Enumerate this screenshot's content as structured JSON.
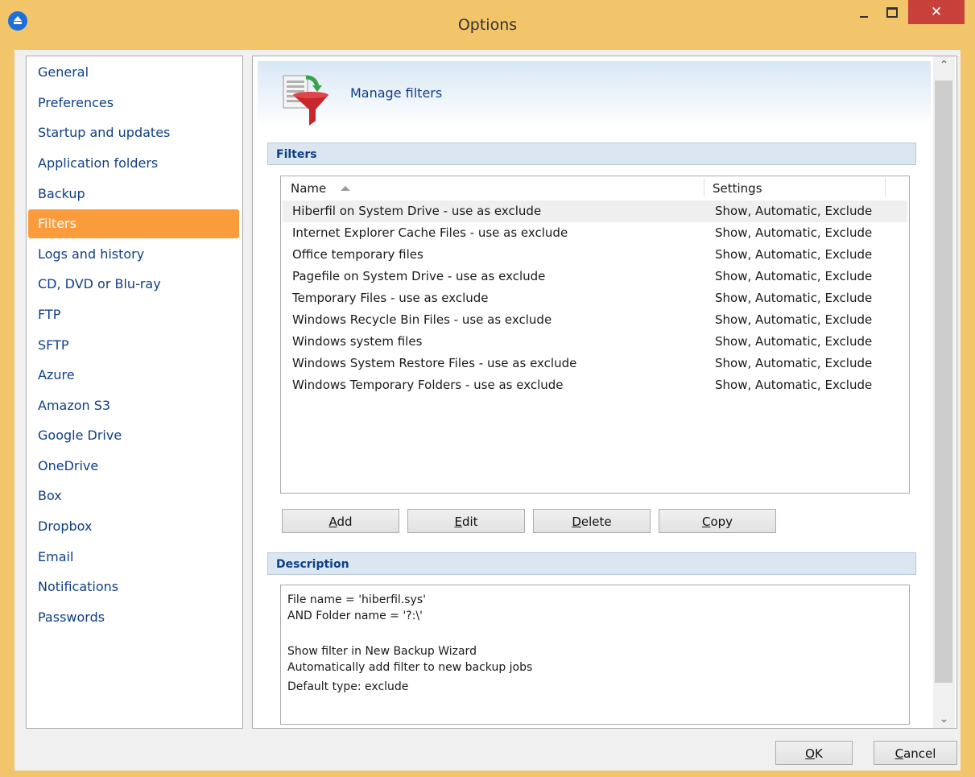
{
  "window": {
    "title": "Options"
  },
  "sidebar": {
    "items": [
      {
        "label": "General"
      },
      {
        "label": "Preferences"
      },
      {
        "label": "Startup and updates"
      },
      {
        "label": "Application folders"
      },
      {
        "label": "Backup"
      },
      {
        "label": "Filters",
        "selected": true
      },
      {
        "label": "Logs and history"
      },
      {
        "label": "CD, DVD or Blu-ray"
      },
      {
        "label": "FTP"
      },
      {
        "label": "SFTP"
      },
      {
        "label": "Azure"
      },
      {
        "label": "Amazon S3"
      },
      {
        "label": "Google Drive"
      },
      {
        "label": "OneDrive"
      },
      {
        "label": "Box"
      },
      {
        "label": "Dropbox"
      },
      {
        "label": "Email"
      },
      {
        "label": "Notifications"
      },
      {
        "label": "Passwords"
      }
    ]
  },
  "main": {
    "title": "Manage filters",
    "filters_section": "Filters",
    "columns": {
      "name": "Name",
      "settings": "Settings"
    },
    "rows": [
      {
        "name": "Hiberfil on System Drive - use as exclude",
        "settings": "Show, Automatic, Exclude",
        "selected": true
      },
      {
        "name": "Internet Explorer Cache Files - use as exclude",
        "settings": "Show, Automatic, Exclude"
      },
      {
        "name": "Office temporary files",
        "settings": "Show, Automatic, Exclude"
      },
      {
        "name": "Pagefile on System Drive - use as exclude",
        "settings": "Show, Automatic, Exclude"
      },
      {
        "name": "Temporary Files - use as exclude",
        "settings": "Show, Automatic, Exclude"
      },
      {
        "name": "Windows Recycle Bin Files - use as exclude",
        "settings": "Show, Automatic, Exclude"
      },
      {
        "name": "Windows system files",
        "settings": "Show, Automatic, Exclude"
      },
      {
        "name": "Windows System Restore Files - use as exclude",
        "settings": "Show, Automatic, Exclude"
      },
      {
        "name": "Windows Temporary Folders - use as exclude",
        "settings": "Show, Automatic, Exclude"
      }
    ],
    "buttons": {
      "add": {
        "mnemonic": "A",
        "rest": "dd"
      },
      "edit": {
        "mnemonic": "E",
        "rest": "dit"
      },
      "delete": {
        "mnemonic": "D",
        "rest": "elete"
      },
      "copy": {
        "mnemonic": "C",
        "rest": "opy"
      }
    },
    "description_section": "Description",
    "description_lines": [
      "File name = 'hiberfil.sys'",
      "AND Folder name = '?:\\'",
      "",
      "Show filter in New Backup Wizard",
      "Automatically add filter to new backup jobs",
      "Default type: exclude"
    ]
  },
  "footer": {
    "ok": {
      "mnemonic": "O",
      "rest": "K"
    },
    "cancel": {
      "mnemonic": "C",
      "rest": "ancel"
    }
  }
}
